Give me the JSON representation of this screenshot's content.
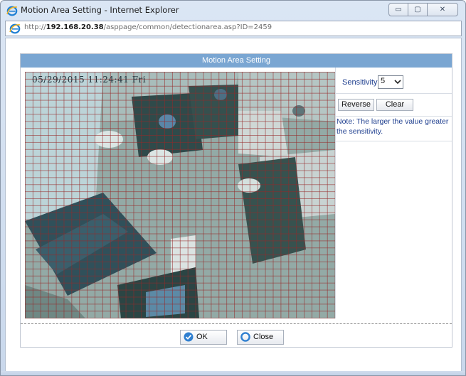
{
  "window": {
    "title": "Motion Area Setting - Internet Explorer",
    "address_prefix": "http://",
    "address_host": "192.168.20.38",
    "address_path": "/asppage/common/detectionarea.asp?ID=2459",
    "buttons": {
      "minimize": "▭",
      "maximize": "▢",
      "close": "✕"
    }
  },
  "dialog": {
    "title": "Motion Area Setting",
    "video": {
      "timestamp": "05/29/2015 11:24:41 Fri"
    },
    "panel": {
      "sensitivity_label": "Sensitivity:",
      "sensitivity_value": "5",
      "reverse_label": "Reverse",
      "clear_label": "Clear",
      "note": "Note: The larger the value greater the sensitivity."
    },
    "footer": {
      "ok_label": "OK",
      "close_label": "Close"
    }
  },
  "icons": {
    "title": "ie-logo-icon",
    "address": "ie-logo-icon",
    "ok": "check-circle-icon",
    "close": "circle-icon"
  },
  "colors": {
    "dialog_header": "#7aa6d2",
    "label_text": "#1f3f8f",
    "grid_line": "#962828"
  }
}
